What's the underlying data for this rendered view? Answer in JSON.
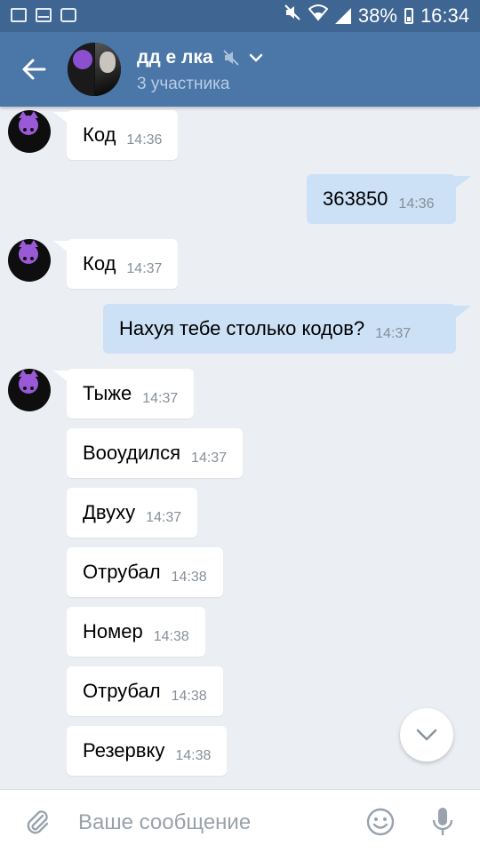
{
  "status_bar": {
    "battery": "38%",
    "time": "16:34"
  },
  "header": {
    "title": "дд е лка",
    "subtitle": "3 участника"
  },
  "messages": [
    {
      "dir": "in",
      "text": "Код",
      "time": "14:36"
    },
    {
      "dir": "out",
      "text": "363850",
      "time": "14:36"
    },
    {
      "dir": "in",
      "text": "Код",
      "time": "14:37"
    },
    {
      "dir": "out",
      "text": "Нахуя тебе столько кодов?",
      "time": "14:37"
    },
    {
      "dir": "in",
      "text": "Тыже",
      "time": "14:37"
    },
    {
      "dir": "in",
      "text": "Вооудился",
      "time": "14:37"
    },
    {
      "dir": "in",
      "text": "Двуху",
      "time": "14:37"
    },
    {
      "dir": "in",
      "text": "Отрубал",
      "time": "14:38"
    },
    {
      "dir": "in",
      "text": "Номер",
      "time": "14:38"
    },
    {
      "dir": "in",
      "text": "Отрубал",
      "time": "14:38"
    },
    {
      "dir": "in",
      "text": "Резервку",
      "time": "14:38"
    }
  ],
  "composer": {
    "placeholder": "Ваше сообщение"
  },
  "colors": {
    "header": "#4a76a8",
    "status_bar": "#3f6593",
    "chat_background": "#ebeef3",
    "incoming_bubble": "#ffffff",
    "outgoing_bubble": "#cce0f6"
  }
}
